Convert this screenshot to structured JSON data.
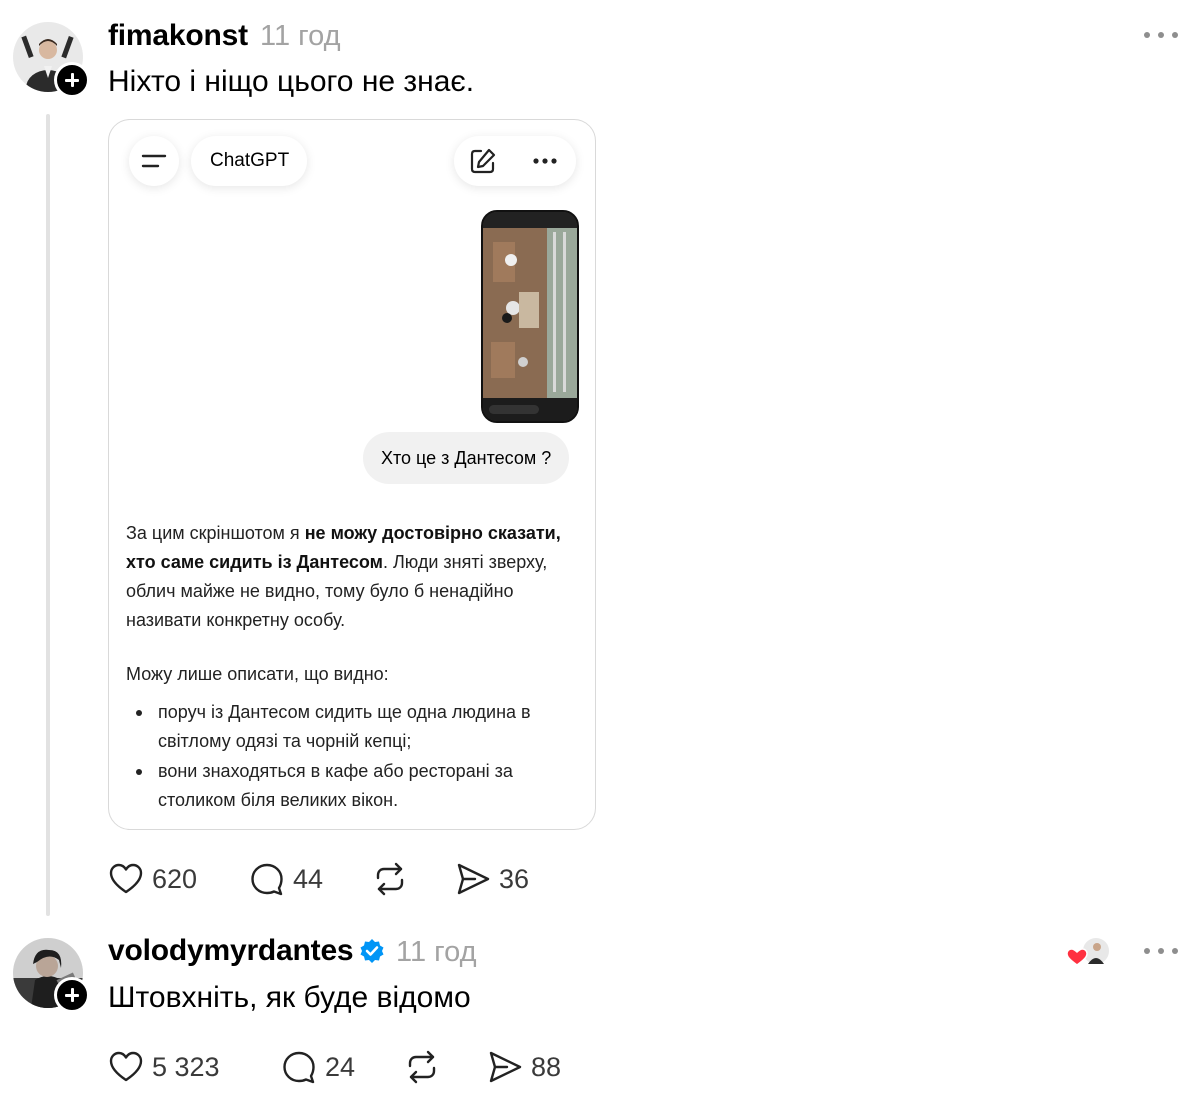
{
  "post": {
    "username": "fimakonst",
    "time": "11 год",
    "text": "Ніхто і ніщо цього не знає.",
    "card": {
      "title": "ChatGPT",
      "user_question": "Хто це з Дантесом ?",
      "answer": {
        "p1_a": "За цим скріншотом я ",
        "p1_bold": "не можу достовірно сказати, хто саме сидить із Дантесом",
        "p1_b": ". Люди зняті зверху, облич майже не видно, тому було б ненадійно називати конкретну особу.",
        "p2": "Можу лише описати, що видно:",
        "bullets": [
          "поруч із Дантесом сидить ще одна людина в світлому одязі та чорній кепці;",
          "вони знаходяться в кафе або ресторані за столиком біля великих вікон."
        ]
      }
    },
    "stats": {
      "likes": "620",
      "replies": "44",
      "shares": "36"
    }
  },
  "reply": {
    "username": "volodymyrdantes",
    "verified": true,
    "time": "11 год",
    "text": "Штовхніть, як буде відомо",
    "stats": {
      "likes": "5 323",
      "replies": "24",
      "shares": "88"
    }
  },
  "colors": {
    "muted": "#a3a3a3",
    "verified_blue": "#0095f6",
    "heart_red": "#ff3040",
    "thread_line": "#e2e2e2"
  },
  "icons": [
    "plus-icon",
    "more-icon",
    "menu-icon",
    "new-chat-icon",
    "heart-icon",
    "comment-icon",
    "repost-icon",
    "share-icon",
    "verified-icon"
  ]
}
